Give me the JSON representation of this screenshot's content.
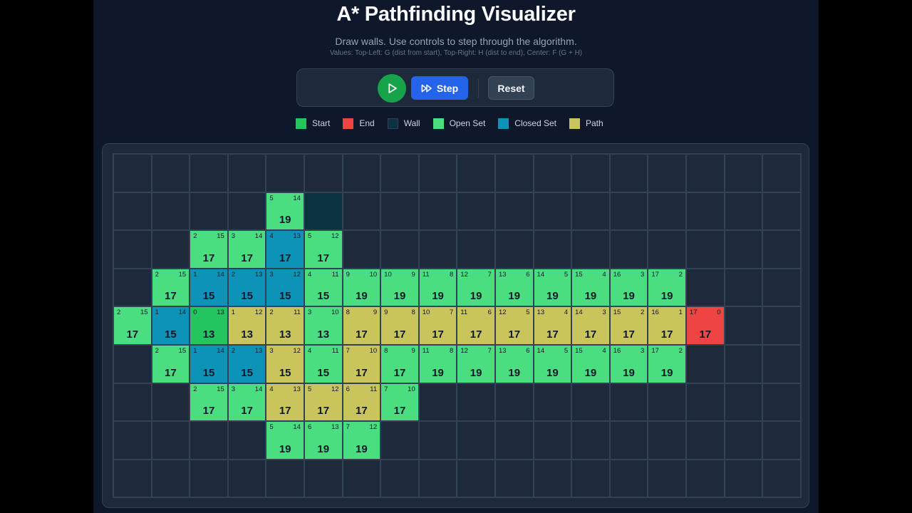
{
  "header": {
    "title": "A* Pathfinding Visualizer",
    "subtitle": "Draw walls. Use controls to step through the algorithm.",
    "hint": "Values: Top-Left: G (dist from start), Top-Right: H (dist to end), Center: F (G + H)"
  },
  "controls": {
    "play_icon": "play-icon",
    "step_icon": "fast-forward-icon",
    "step_label": "Step",
    "reset_label": "Reset"
  },
  "legend": [
    {
      "label": "Start",
      "color": "#22c55e"
    },
    {
      "label": "End",
      "color": "#ef4444"
    },
    {
      "label": "Wall",
      "color": "#0c3140"
    },
    {
      "label": "Open Set",
      "color": "#4ade80"
    },
    {
      "label": "Closed Set",
      "color": "#0e93b8"
    },
    {
      "label": "Path",
      "color": "#c9c45b"
    }
  ],
  "colors": {
    "open": "#4ade80",
    "closed": "#0e93b8",
    "path": "#c9c45b",
    "start": "#22c55e",
    "end": "#ef4444",
    "wall": "#0c3140",
    "empty": "#1e293b"
  },
  "grid": {
    "rows": 9,
    "cols": 18,
    "cells": [
      {
        "r": 1,
        "c": 4,
        "t": "open",
        "g": 5,
        "h": 14,
        "f": 19
      },
      {
        "r": 1,
        "c": 5,
        "t": "wall"
      },
      {
        "r": 2,
        "c": 2,
        "t": "open",
        "g": 2,
        "h": 15,
        "f": 17
      },
      {
        "r": 2,
        "c": 3,
        "t": "open",
        "g": 3,
        "h": 14,
        "f": 17
      },
      {
        "r": 2,
        "c": 4,
        "t": "closed",
        "g": 4,
        "h": 13,
        "f": 17
      },
      {
        "r": 2,
        "c": 5,
        "t": "open",
        "g": 5,
        "h": 12,
        "f": 17
      },
      {
        "r": 3,
        "c": 1,
        "t": "open",
        "g": 2,
        "h": 15,
        "f": 17
      },
      {
        "r": 3,
        "c": 2,
        "t": "closed",
        "g": 1,
        "h": 14,
        "f": 15
      },
      {
        "r": 3,
        "c": 3,
        "t": "closed",
        "g": 2,
        "h": 13,
        "f": 15
      },
      {
        "r": 3,
        "c": 4,
        "t": "closed",
        "g": 3,
        "h": 12,
        "f": 15
      },
      {
        "r": 3,
        "c": 5,
        "t": "open",
        "g": 4,
        "h": 11,
        "f": 15
      },
      {
        "r": 3,
        "c": 6,
        "t": "open",
        "g": 9,
        "h": 10,
        "f": 19
      },
      {
        "r": 3,
        "c": 7,
        "t": "open",
        "g": 10,
        "h": 9,
        "f": 19
      },
      {
        "r": 3,
        "c": 8,
        "t": "open",
        "g": 11,
        "h": 8,
        "f": 19
      },
      {
        "r": 3,
        "c": 9,
        "t": "open",
        "g": 12,
        "h": 7,
        "f": 19
      },
      {
        "r": 3,
        "c": 10,
        "t": "open",
        "g": 13,
        "h": 6,
        "f": 19
      },
      {
        "r": 3,
        "c": 11,
        "t": "open",
        "g": 14,
        "h": 5,
        "f": 19
      },
      {
        "r": 3,
        "c": 12,
        "t": "open",
        "g": 15,
        "h": 4,
        "f": 19
      },
      {
        "r": 3,
        "c": 13,
        "t": "open",
        "g": 16,
        "h": 3,
        "f": 19
      },
      {
        "r": 3,
        "c": 14,
        "t": "open",
        "g": 17,
        "h": 2,
        "f": 19
      },
      {
        "r": 4,
        "c": 0,
        "t": "open",
        "g": 2,
        "h": 15,
        "f": 17
      },
      {
        "r": 4,
        "c": 1,
        "t": "closed",
        "g": 1,
        "h": 14,
        "f": 15
      },
      {
        "r": 4,
        "c": 2,
        "t": "start",
        "g": 0,
        "h": 13,
        "f": 13
      },
      {
        "r": 4,
        "c": 3,
        "t": "path",
        "g": 1,
        "h": 12,
        "f": 13
      },
      {
        "r": 4,
        "c": 4,
        "t": "path",
        "g": 2,
        "h": 11,
        "f": 13
      },
      {
        "r": 4,
        "c": 5,
        "t": "open",
        "g": 3,
        "h": 10,
        "f": 13
      },
      {
        "r": 4,
        "c": 6,
        "t": "path",
        "g": 8,
        "h": 9,
        "f": 17
      },
      {
        "r": 4,
        "c": 7,
        "t": "path",
        "g": 9,
        "h": 8,
        "f": 17
      },
      {
        "r": 4,
        "c": 8,
        "t": "path",
        "g": 10,
        "h": 7,
        "f": 17
      },
      {
        "r": 4,
        "c": 9,
        "t": "path",
        "g": 11,
        "h": 6,
        "f": 17
      },
      {
        "r": 4,
        "c": 10,
        "t": "path",
        "g": 12,
        "h": 5,
        "f": 17
      },
      {
        "r": 4,
        "c": 11,
        "t": "path",
        "g": 13,
        "h": 4,
        "f": 17
      },
      {
        "r": 4,
        "c": 12,
        "t": "path",
        "g": 14,
        "h": 3,
        "f": 17
      },
      {
        "r": 4,
        "c": 13,
        "t": "path",
        "g": 15,
        "h": 2,
        "f": 17
      },
      {
        "r": 4,
        "c": 14,
        "t": "path",
        "g": 16,
        "h": 1,
        "f": 17
      },
      {
        "r": 4,
        "c": 15,
        "t": "end",
        "g": 17,
        "h": 0,
        "f": 17
      },
      {
        "r": 5,
        "c": 1,
        "t": "open",
        "g": 2,
        "h": 15,
        "f": 17
      },
      {
        "r": 5,
        "c": 2,
        "t": "closed",
        "g": 1,
        "h": 14,
        "f": 15
      },
      {
        "r": 5,
        "c": 3,
        "t": "closed",
        "g": 2,
        "h": 13,
        "f": 15
      },
      {
        "r": 5,
        "c": 4,
        "t": "path",
        "g": 3,
        "h": 12,
        "f": 15
      },
      {
        "r": 5,
        "c": 5,
        "t": "open",
        "g": 4,
        "h": 11,
        "f": 15
      },
      {
        "r": 5,
        "c": 6,
        "t": "path",
        "g": 7,
        "h": 10,
        "f": 17
      },
      {
        "r": 5,
        "c": 7,
        "t": "open",
        "g": 8,
        "h": 9,
        "f": 17
      },
      {
        "r": 5,
        "c": 8,
        "t": "open",
        "g": 11,
        "h": 8,
        "f": 19
      },
      {
        "r": 5,
        "c": 9,
        "t": "open",
        "g": 12,
        "h": 7,
        "f": 19
      },
      {
        "r": 5,
        "c": 10,
        "t": "open",
        "g": 13,
        "h": 6,
        "f": 19
      },
      {
        "r": 5,
        "c": 11,
        "t": "open",
        "g": 14,
        "h": 5,
        "f": 19
      },
      {
        "r": 5,
        "c": 12,
        "t": "open",
        "g": 15,
        "h": 4,
        "f": 19
      },
      {
        "r": 5,
        "c": 13,
        "t": "open",
        "g": 16,
        "h": 3,
        "f": 19
      },
      {
        "r": 5,
        "c": 14,
        "t": "open",
        "g": 17,
        "h": 2,
        "f": 19
      },
      {
        "r": 6,
        "c": 2,
        "t": "open",
        "g": 2,
        "h": 15,
        "f": 17
      },
      {
        "r": 6,
        "c": 3,
        "t": "open",
        "g": 3,
        "h": 14,
        "f": 17
      },
      {
        "r": 6,
        "c": 4,
        "t": "path",
        "g": 4,
        "h": 13,
        "f": 17
      },
      {
        "r": 6,
        "c": 5,
        "t": "path",
        "g": 5,
        "h": 12,
        "f": 17
      },
      {
        "r": 6,
        "c": 6,
        "t": "path",
        "g": 6,
        "h": 11,
        "f": 17
      },
      {
        "r": 6,
        "c": 7,
        "t": "open",
        "g": 7,
        "h": 10,
        "f": 17
      },
      {
        "r": 7,
        "c": 4,
        "t": "open",
        "g": 5,
        "h": 14,
        "f": 19
      },
      {
        "r": 7,
        "c": 5,
        "t": "open",
        "g": 6,
        "h": 13,
        "f": 19
      },
      {
        "r": 7,
        "c": 6,
        "t": "open",
        "g": 7,
        "h": 12,
        "f": 19
      }
    ]
  }
}
